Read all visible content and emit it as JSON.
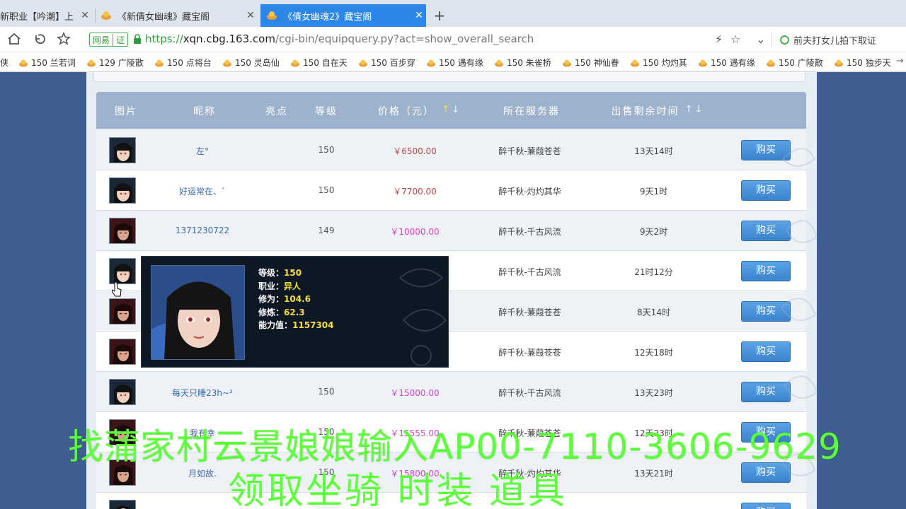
{
  "browser": {
    "tabs": [
      {
        "label": "新职业【吟潮】上",
        "active": false
      },
      {
        "label": "《新倩女幽魂》藏宝阁",
        "active": false
      },
      {
        "label": "《倩女幽魂2》藏宝阁",
        "active": true
      }
    ],
    "site_badge": {
      "name": "网易",
      "cert": "证"
    },
    "url": {
      "proto": "https://",
      "host": "xqn.cbg.163.com",
      "path": "/cgi-bin/equipquery.py?act=show_overall_search"
    },
    "search_hint": "前夫打女儿拍下取证",
    "bookmarks": [
      "侠",
      "150 兰若词",
      "129 广陵散",
      "150 点将台",
      "150 灵岛仙",
      "150 自在天",
      "150 百步穿",
      "150 遇有缘",
      "150 朱雀桥",
      "150 神仙眷",
      "150 灼灼其",
      "150 遇有缘",
      "150 广陵散",
      "150 独步天"
    ]
  },
  "table": {
    "headers": {
      "image": "图片",
      "nickname": "昵称",
      "highlight": "亮点",
      "level": "等级",
      "price": "价格（元）",
      "server": "所在服务器",
      "time_left": "出售剩余时间"
    },
    "buy_label": "购买",
    "rows": [
      {
        "name": "左°",
        "level": "150",
        "price": "￥6500.00",
        "price_color": "red",
        "server": "醉千秋-蒹葭苍苍",
        "time": "13天14时",
        "avatar": "female"
      },
      {
        "name": "好运常在、`",
        "level": "150",
        "price": "￥7700.00",
        "price_color": "red",
        "server": "醉千秋-灼灼其华",
        "time": "9天1时",
        "avatar": "female"
      },
      {
        "name": "1371230722",
        "level": "149",
        "price": "￥10000.00",
        "price_color": "pink",
        "server": "醉千秋-千古风流",
        "time": "9天2时",
        "avatar": "male"
      },
      {
        "name": "",
        "level": "",
        "price": "",
        "price_color": "pink",
        "server": "醉千秋-千古风流",
        "time": "21时12分",
        "avatar": "female"
      },
      {
        "name": "",
        "level": "",
        "price": "",
        "price_color": "pink",
        "server": "醉千秋-蒹葭苍苍",
        "time": "8天14时",
        "avatar": "male"
      },
      {
        "name": "",
        "level": "",
        "price": "",
        "price_color": "pink",
        "server": "醉千秋-蒹葭苍苍",
        "time": "12天18时",
        "avatar": "male"
      },
      {
        "name": "每天只睡23h~²",
        "level": "150",
        "price": "￥15000.00",
        "price_color": "pink",
        "server": "醉千秋-千古风流",
        "time": "13天23时",
        "avatar": "female"
      },
      {
        "name": "我有幸",
        "level": "150",
        "price": "￥15555.00",
        "price_color": "pink",
        "server": "醉千秋-蒹葭苍苍",
        "time": "12天23时",
        "avatar": "male"
      },
      {
        "name": "月如故.",
        "level": "150",
        "price": "￥15800.00",
        "price_color": "pink",
        "server": "醉千秋-灼灼其华",
        "time": "13天21时",
        "avatar": "male"
      }
    ]
  },
  "tooltip": {
    "lines": [
      {
        "label": "等级：",
        "value": "150"
      },
      {
        "label": "职业：",
        "value": "异人"
      },
      {
        "label": "修为：",
        "value": "104.6"
      },
      {
        "label": "修炼：",
        "value": "62.3"
      },
      {
        "label": "能力值：",
        "value": "1157304"
      }
    ]
  },
  "overlay": {
    "line1": "找蒲家村云景娘娘输入AP00-7110-3606-9629",
    "line2": "领取坐骑 时装 道具"
  },
  "colors": {
    "accent_tab": "#2d87e8",
    "header_bg": "#9db2cd",
    "buy_button": "#4a93da",
    "price_red": "#b44848",
    "price_pink": "#d345c6",
    "overlay_text": "#5cff3a"
  }
}
